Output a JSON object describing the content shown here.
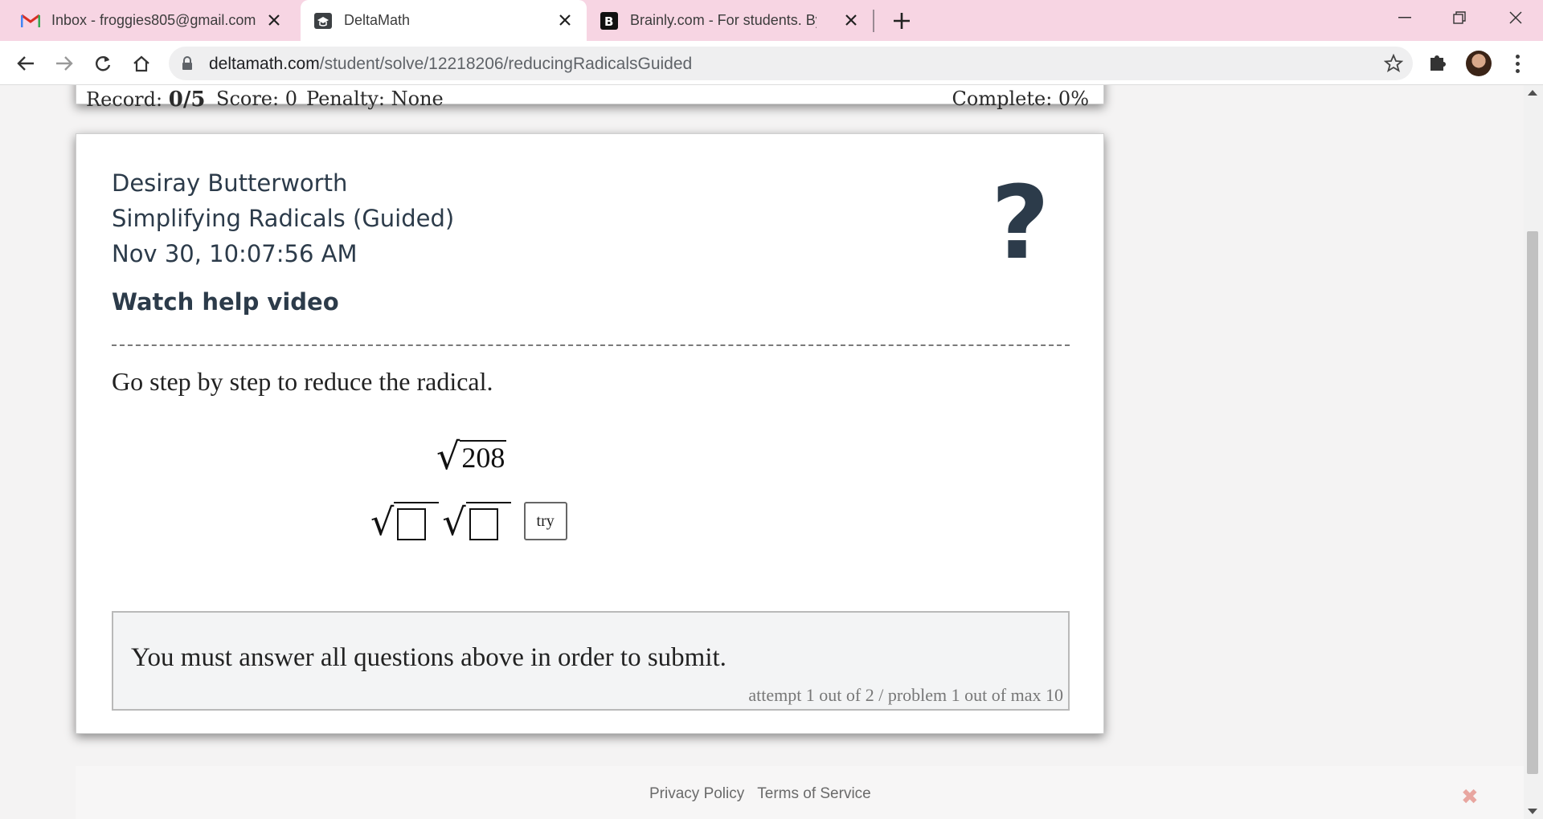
{
  "browser": {
    "tabs": [
      {
        "title": "Inbox - froggies805@gmail.com",
        "icon": "gmail-icon",
        "active": false
      },
      {
        "title": "DeltaMath",
        "icon": "deltamath-icon",
        "active": true
      },
      {
        "title": "Brainly.com - For students. By stu",
        "icon": "brainly-icon",
        "active": false
      }
    ],
    "url_host": "deltamath.com",
    "url_path": "/student/solve/12218206/reducingRadicalsGuided"
  },
  "status": {
    "record_label": "Record:",
    "record_value": "0/5",
    "score": "Score: 0",
    "penalty": "Penalty: None",
    "complete": "Complete: 0%"
  },
  "problem": {
    "student_name": "Desiray Butterworth",
    "assignment": "Simplifying Radicals (Guided)",
    "timestamp": "Nov 30, 10:07:56 AM",
    "help_video": "Watch help video",
    "help_symbol": "?",
    "prompt": "Go step by step to reduce the radical.",
    "radicand": "208",
    "radical_symbol": "√",
    "try_label": "try",
    "submit_message": "You must answer all questions above in order to submit.",
    "attempt_info": "attempt 1 out of 2 / problem 1 out of max 10"
  },
  "footer": {
    "privacy": "Privacy Policy",
    "terms": "Terms of Service",
    "close_symbol": "✖"
  },
  "colors": {
    "tabbar": "#f7d5e3",
    "heading_text": "#2c3b4a",
    "page_bg": "#f4f3f3"
  }
}
